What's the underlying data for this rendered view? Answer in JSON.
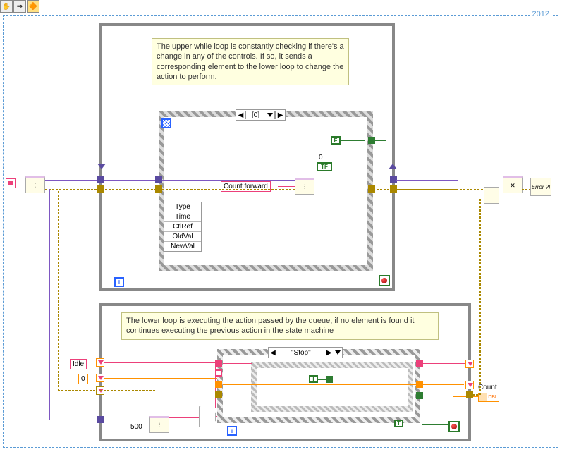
{
  "toolbar": {
    "hand": "✋",
    "arrow": "⇒",
    "run": "▶"
  },
  "outer_frame": {
    "year": "2012"
  },
  "comments": {
    "upper": "The upper while loop is constantly checking if there's a change in any of the controls. If so, it sends a corresponding element to the lower loop to change the action to perform.",
    "lower": "The lower loop is executing the action passed by the queue, if no element is found it continues executing the previous action in the state machine"
  },
  "event_struct": {
    "selector_text": "[0]",
    "terminals": [
      "Type",
      "Time",
      "CtlRef",
      "OldVal",
      "NewVal"
    ],
    "false_const": "F",
    "enqueue_const": "Count forward",
    "tf_label": "0",
    "tf_value": "TF"
  },
  "case_struct": {
    "selector_text": "\"Stop\"",
    "true1": "T",
    "true2": "T"
  },
  "lower_loop": {
    "idle_const": "Idle",
    "zero_const": "0",
    "timeout_const": "500",
    "count_label": "Count",
    "dbl_txt": "DBL"
  },
  "nodes": {
    "obtain_q": "⫶⫶",
    "enqueue": "⫶",
    "dequeue": "⫶",
    "release_q": "✕",
    "merge_err": "",
    "error_handler": "Error ?!",
    "i_term": "i"
  }
}
